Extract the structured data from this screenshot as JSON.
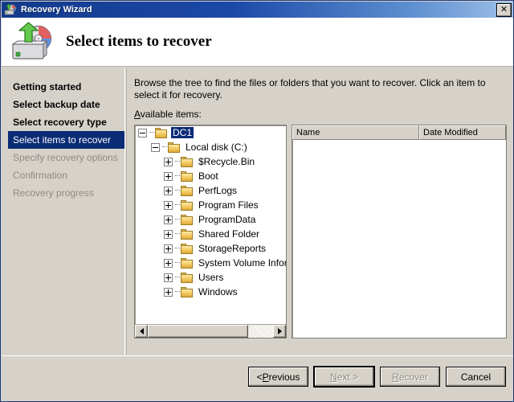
{
  "window": {
    "title": "Recovery Wizard",
    "title_icon": "recovery-drive-icon",
    "close_label": "✕",
    "accent_titlebar": "#133a8c",
    "accent_selection": "#0a2b75",
    "face_color": "#d6d2ca"
  },
  "header": {
    "title": "Select items to recover",
    "icon": "recovery-drive-icon"
  },
  "sidebar": {
    "items": [
      {
        "label": "Getting started",
        "state": "completed"
      },
      {
        "label": "Select backup date",
        "state": "completed"
      },
      {
        "label": "Select recovery type",
        "state": "completed"
      },
      {
        "label": "Select items to recover",
        "state": "current"
      },
      {
        "label": "Specify recovery options",
        "state": "pending"
      },
      {
        "label": "Confirmation",
        "state": "pending"
      },
      {
        "label": "Recovery progress",
        "state": "pending"
      }
    ]
  },
  "content": {
    "instructions": "Browse the tree to find the files or folders that you want to recover. Click an item to select it for recovery.",
    "available_label_accel": "A",
    "available_label_rest": "vailable items:"
  },
  "tree": {
    "nodes": [
      {
        "label": "DC1",
        "indent": 0,
        "expander": "minus",
        "selected": true,
        "icon": "folder-icon"
      },
      {
        "label": "Local disk (C:)",
        "indent": 1,
        "expander": "minus",
        "selected": false,
        "icon": "folder-icon"
      },
      {
        "label": "$Recycle.Bin",
        "indent": 2,
        "expander": "plus",
        "selected": false,
        "icon": "folder-icon"
      },
      {
        "label": "Boot",
        "indent": 2,
        "expander": "plus",
        "selected": false,
        "icon": "folder-icon"
      },
      {
        "label": "PerfLogs",
        "indent": 2,
        "expander": "plus",
        "selected": false,
        "icon": "folder-icon"
      },
      {
        "label": "Program Files",
        "indent": 2,
        "expander": "plus",
        "selected": false,
        "icon": "folder-icon"
      },
      {
        "label": "ProgramData",
        "indent": 2,
        "expander": "plus",
        "selected": false,
        "icon": "folder-icon"
      },
      {
        "label": "Shared Folder",
        "indent": 2,
        "expander": "plus",
        "selected": false,
        "icon": "folder-icon"
      },
      {
        "label": "StorageReports",
        "indent": 2,
        "expander": "plus",
        "selected": false,
        "icon": "folder-icon"
      },
      {
        "label": "System Volume Inform",
        "indent": 2,
        "expander": "plus",
        "selected": false,
        "icon": "folder-icon"
      },
      {
        "label": "Users",
        "indent": 2,
        "expander": "plus",
        "selected": false,
        "icon": "folder-icon"
      },
      {
        "label": "Windows",
        "indent": 2,
        "expander": "plus",
        "selected": false,
        "icon": "folder-icon"
      }
    ],
    "hscroll": {
      "thumb_percent": 80
    }
  },
  "list": {
    "columns": [
      {
        "label": "Name"
      },
      {
        "label": "Date Modified"
      }
    ],
    "rows": []
  },
  "footer": {
    "buttons": [
      {
        "name": "previous",
        "accel": "P",
        "before": "< ",
        "after": "revious",
        "disabled": false,
        "focused": false
      },
      {
        "name": "next",
        "accel": "N",
        "before": "",
        "after": "ext >",
        "disabled": true,
        "focused": true
      },
      {
        "name": "recover",
        "accel": "R",
        "before": "",
        "after": "ecover",
        "disabled": true,
        "focused": false
      },
      {
        "name": "cancel",
        "accel": "",
        "before": "Cancel",
        "after": "",
        "disabled": false,
        "focused": false
      }
    ]
  }
}
